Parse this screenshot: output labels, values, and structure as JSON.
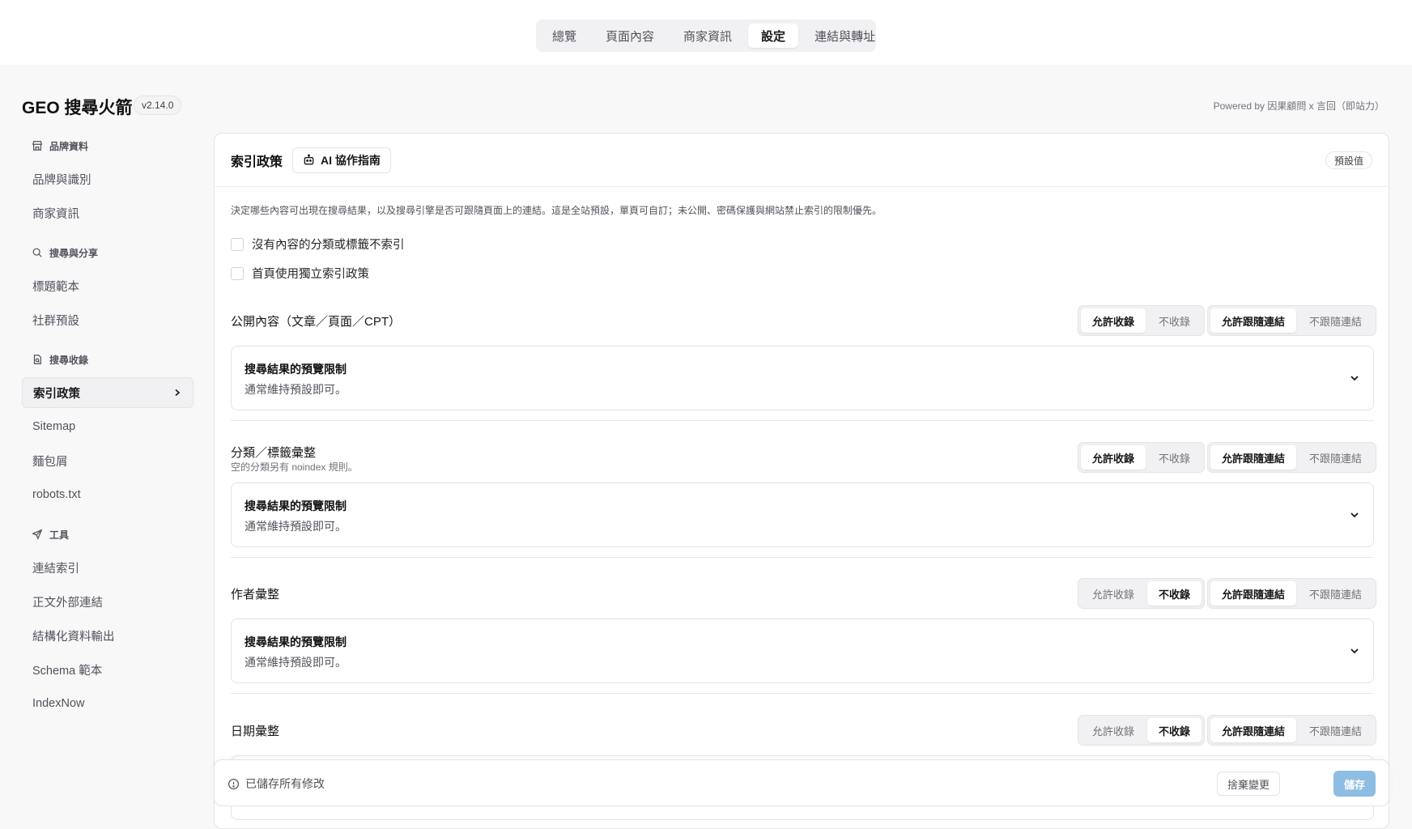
{
  "top_tabs": [
    {
      "label": "總覽"
    },
    {
      "label": "頁面內容"
    },
    {
      "label": "商家資訊"
    },
    {
      "label": "設定"
    },
    {
      "label": "連結與轉址"
    }
  ],
  "header": {
    "title": "GEO 搜尋火箭",
    "version": "v2.14.0",
    "powered_by": "Powered by 因果顧問 x 言回（即站力）"
  },
  "sidebar": {
    "brand_section": "品牌資料",
    "brand_items": [
      "品牌與識別",
      "商家資訊"
    ],
    "search_section": "搜尋與分享",
    "search_items": [
      "標題範本",
      "社群預設"
    ],
    "index_section": "搜尋收錄",
    "index_items": [
      "索引政策",
      "Sitemap",
      "麵包屑",
      "robots.txt"
    ],
    "tools_section": "工具",
    "tools_items": [
      "連結索引",
      "正文外部連結",
      "結構化資料輸出",
      "Schema 範本",
      "IndexNow"
    ]
  },
  "main": {
    "title": "索引政策",
    "guide_label": "AI 協作指南",
    "default_label": "預設值",
    "description": "決定哪些內容可出現在搜尋結果，以及搜尋引擎是否可跟隨頁面上的連結。這是全站預設，單頁可自訂；未公開、密碼保護與網站禁止索引的限制優先。",
    "checks": [
      "沒有內容的分類或標籤不索引",
      "首頁使用獨立索引政策"
    ],
    "index_options": [
      "允許收錄",
      "不收錄"
    ],
    "follow_options": [
      "允許跟隨連結",
      "不跟隨連結"
    ],
    "preview_title": "搜尋結果的預覽限制",
    "preview_sub": "通常維持預設即可。",
    "sections": [
      {
        "label": "公開內容（文章／頁面／CPT）",
        "sub": "",
        "index": "允許收錄",
        "follow": "允許跟隨連結"
      },
      {
        "label": "分類／標籤彙整",
        "sub": "空的分類另有 noindex 規則。",
        "index": "允許收錄",
        "follow": "允許跟隨連結"
      },
      {
        "label": "作者彙整",
        "sub": "",
        "index": "不收錄",
        "follow": "允許跟隨連結"
      },
      {
        "label": "日期彙整",
        "sub": "",
        "index": "不收錄",
        "follow": "允許跟隨連結"
      }
    ]
  },
  "savebar": {
    "status": "已儲存所有修改",
    "discard_label": "捨棄變更",
    "save_label": "儲存"
  }
}
